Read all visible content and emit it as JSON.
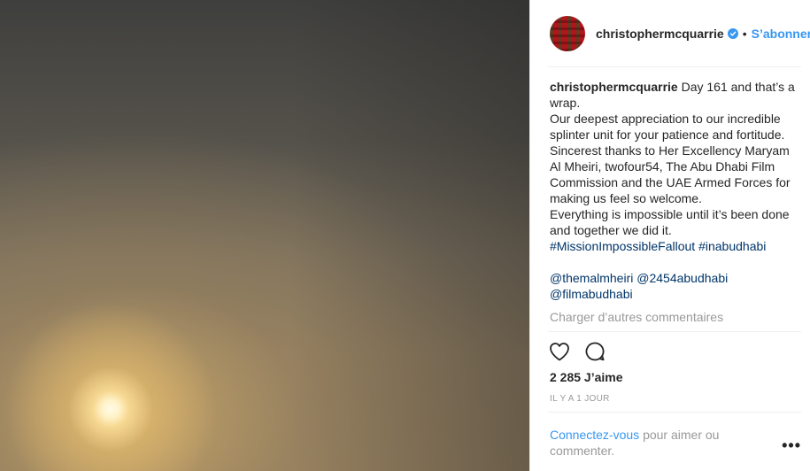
{
  "post": {
    "author": "christophermcquarrie",
    "separator": "•",
    "follow_label": "S’abonner",
    "caption": {
      "user": "christophermcquarrie",
      "line1": "Day 161 and that’s a wrap.",
      "line2": "Our deepest appreciation to our incredible splinter unit for your patience and fortitude.",
      "line3": "Sincerest thanks to Her Excellency Maryam Al Mheiri, twofour54, The Abu Dhabi Film Commission and the UAE Armed Forces for making us feel so welcome.",
      "line4": "Everything is impossible until it’s been done and together we did it.",
      "hashtags": [
        "#MissionImpossibleFallout",
        "#inabudhabi"
      ]
    },
    "comment": {
      "mentions": [
        "@themalmheiri",
        "@2454abudhabi",
        "@filmabudhabi"
      ]
    },
    "load_more_label": "Charger d’autres commentaires",
    "likes_label": "2 285 J’aime",
    "timestamp": "IL Y A 1 JOUR",
    "login": {
      "link": "Connectez-vous",
      "text": "pour aimer ou commenter."
    },
    "more_label": "•••"
  },
  "icons": {
    "verified": "verified-badge-icon",
    "like": "heart-icon",
    "comment": "speech-bubble-icon",
    "more": "more-options-icon"
  },
  "colors": {
    "link_blue": "#3897f0",
    "tag_blue": "#003569",
    "muted": "#999999",
    "text": "#262626"
  }
}
